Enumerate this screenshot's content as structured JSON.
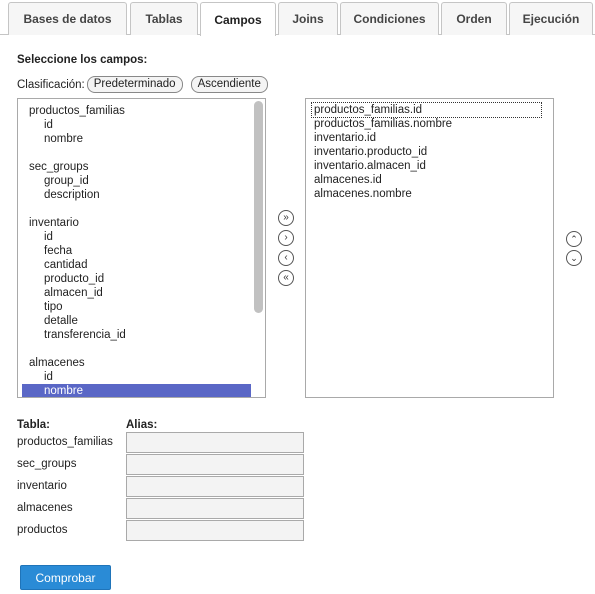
{
  "tabs": [
    {
      "label": "Bases de datos",
      "active": false
    },
    {
      "label": "Tablas",
      "active": false
    },
    {
      "label": "Campos",
      "active": true
    },
    {
      "label": "Joins",
      "active": false
    },
    {
      "label": "Condiciones",
      "active": false
    },
    {
      "label": "Orden",
      "active": false
    },
    {
      "label": "Ejecución",
      "active": false
    }
  ],
  "heading": "Seleccione los campos:",
  "classification": {
    "label": "Clasificación:",
    "default_button": "Predeterminado",
    "ascending_button": "Ascendiente"
  },
  "available_fields": [
    {
      "table": "productos_familias",
      "fields": [
        "id",
        "nombre"
      ]
    },
    {
      "table": "sec_groups",
      "fields": [
        "group_id",
        "description"
      ]
    },
    {
      "table": "inventario",
      "fields": [
        "id",
        "fecha",
        "cantidad",
        "producto_id",
        "almacen_id",
        "tipo",
        "detalle",
        "transferencia_id"
      ]
    },
    {
      "table": "almacenes",
      "fields": [
        "id",
        "nombre"
      ]
    }
  ],
  "selected_available": "almacenes.nombre",
  "chosen_fields": [
    "productos_familias.id",
    "productos_familias.nombre",
    "inventario.id",
    "inventario.producto_id",
    "inventario.almacen_id",
    "almacenes.id",
    "almacenes.nombre"
  ],
  "move_buttons": {
    "add_all": "»",
    "add": "›",
    "remove": "‹",
    "remove_all": "«",
    "up": "⌃",
    "down": "⌄"
  },
  "table_header": {
    "table": "Tabla:",
    "alias": "Alias:"
  },
  "alias_rows": [
    {
      "table": "productos_familias",
      "alias": ""
    },
    {
      "table": "sec_groups",
      "alias": ""
    },
    {
      "table": "inventario",
      "alias": ""
    },
    {
      "table": "almacenes",
      "alias": ""
    },
    {
      "table": "productos",
      "alias": ""
    }
  ],
  "submit_label": "Comprobar"
}
